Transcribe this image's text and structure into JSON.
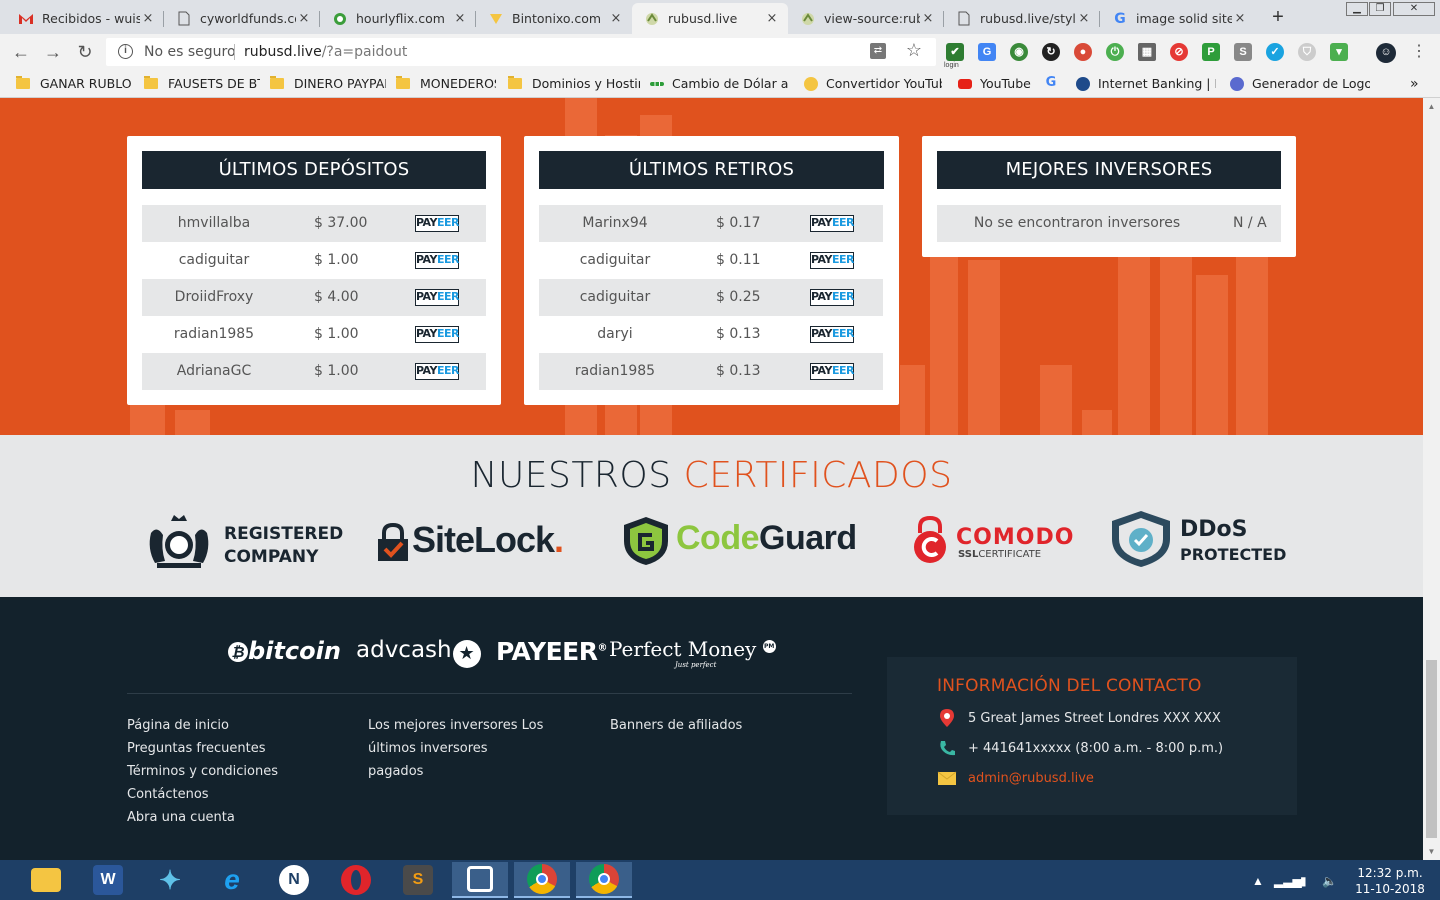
{
  "browser": {
    "tabs": [
      {
        "label": "Recibidos - wuise",
        "icon": "gmail-icon"
      },
      {
        "label": "cyworldfunds.com",
        "icon": "page-icon"
      },
      {
        "label": "hourlyflix.com",
        "icon": "hourlyflix-icon"
      },
      {
        "label": "Bintonixo.com",
        "icon": "bintonixo-icon"
      },
      {
        "label": "rubusd.live",
        "icon": "rubusd-icon"
      },
      {
        "label": "view-source:rubu",
        "icon": "rubusd-icon"
      },
      {
        "label": "rubusd.live/styles",
        "icon": "page-icon"
      },
      {
        "label": "image solid sitelo",
        "icon": "google-icon"
      }
    ],
    "new_tab": "+",
    "security_label": "No es seguro",
    "url_host": "rubusd.live",
    "url_path": "/?a=paidout",
    "close_glyph": "×",
    "login_badge": "login"
  },
  "bookmarks": [
    {
      "label": "GANAR RUBLOS",
      "icon": "folder-icon"
    },
    {
      "label": "FAUSETS DE BTC",
      "icon": "folder-icon"
    },
    {
      "label": "DINERO PAYPAL",
      "icon": "folder-icon"
    },
    {
      "label": "MONEDEROS",
      "icon": "folder-icon"
    },
    {
      "label": "Dominios y Hosting",
      "icon": "folder-icon"
    },
    {
      "label": "Cambio de Dólar amé",
      "icon": "exchange-icon"
    },
    {
      "label": "Convertidor YouTube",
      "icon": "converter-icon"
    },
    {
      "label": "YouTube",
      "icon": "youtube-icon"
    },
    {
      "label": "",
      "icon": "google-icon"
    },
    {
      "label": "Internet Banking | Ba",
      "icon": "bank-icon"
    },
    {
      "label": "Generador de Logos",
      "icon": "logo-generator-icon"
    }
  ],
  "bookmarks_overflow": "»",
  "panels": {
    "deposits": {
      "title": "ÚLTIMOS DEPÓSITOS",
      "rows": [
        {
          "user": "hmvillalba",
          "amount": "$ 37.00",
          "method": "PAYEER"
        },
        {
          "user": "cadiguitar",
          "amount": "$ 1.00",
          "method": "PAYEER"
        },
        {
          "user": "DroiidFroxy",
          "amount": "$ 4.00",
          "method": "PAYEER"
        },
        {
          "user": "radian1985",
          "amount": "$ 1.00",
          "method": "PAYEER"
        },
        {
          "user": "AdrianaGC",
          "amount": "$ 1.00",
          "method": "PAYEER"
        }
      ]
    },
    "withdrawals": {
      "title": "ÚLTIMOS RETIROS",
      "rows": [
        {
          "user": "Marinx94",
          "amount": "$ 0.17",
          "method": "PAYEER"
        },
        {
          "user": "cadiguitar",
          "amount": "$ 0.11",
          "method": "PAYEER"
        },
        {
          "user": "cadiguitar",
          "amount": "$ 0.25",
          "method": "PAYEER"
        },
        {
          "user": "daryi",
          "amount": "$ 0.13",
          "method": "PAYEER"
        },
        {
          "user": "radian1985",
          "amount": "$ 0.13",
          "method": "PAYEER"
        }
      ]
    },
    "investors": {
      "title": "MEJORES INVERSORES",
      "empty_text": "No se encontraron inversores",
      "empty_value": "N / A"
    }
  },
  "certificates": {
    "title_a": "NUESTROS",
    "title_b": "CERTIFICADOS",
    "registered_line1": "REGISTERED",
    "registered_line2": "COMPANY",
    "sitelock": "SiteLock",
    "sitelock_dot": ".",
    "codeguard_a": "Code",
    "codeguard_b": "Guard",
    "comodo": "COMODO",
    "comodo_sub_a": "SSL",
    "comodo_sub_b": "CERTIFICATE",
    "ddos_line1": "DDoS",
    "ddos_line2": "PROTECTED"
  },
  "footer": {
    "payments": [
      "bitcoin",
      "advcash",
      "PAYEER",
      "Perfect Money"
    ],
    "payeer_reg": "®",
    "pm_sub": "Just perfect",
    "pm_badge": "PM",
    "links_col1": [
      "Página de inicio",
      "Preguntas frecuentes",
      "Términos y condiciones",
      "Contáctenos",
      "Abra una cuenta"
    ],
    "links_col2": [
      "Los mejores inversores Los",
      "últimos inversores",
      "pagados"
    ],
    "links_col3": [
      "Banners de afiliados"
    ],
    "contact": {
      "title": "INFORMACIÓN DEL CONTACTO",
      "address": "5 Great James Street Londres XXX XXX",
      "phone": "+ 441641xxxxx (8:00 a.m. - 8:00 p.m.)",
      "email": "admin@rubusd.live"
    }
  },
  "taskbar": {
    "time": "12:32 p.m.",
    "date": "11-10-2018",
    "apps": [
      "file-explorer-icon",
      "word-icon",
      "app-icon",
      "internet-explorer-icon",
      "norton-icon",
      "opera-icon",
      "sublime-icon",
      "app-window-icon",
      "chrome-icon",
      "chrome-icon"
    ]
  },
  "colors": {
    "accent": "#e0521e",
    "dark": "#1a2630",
    "footer": "#13222c",
    "light": "#e6e7e8",
    "payeer_blue": "#1a9ae0"
  }
}
